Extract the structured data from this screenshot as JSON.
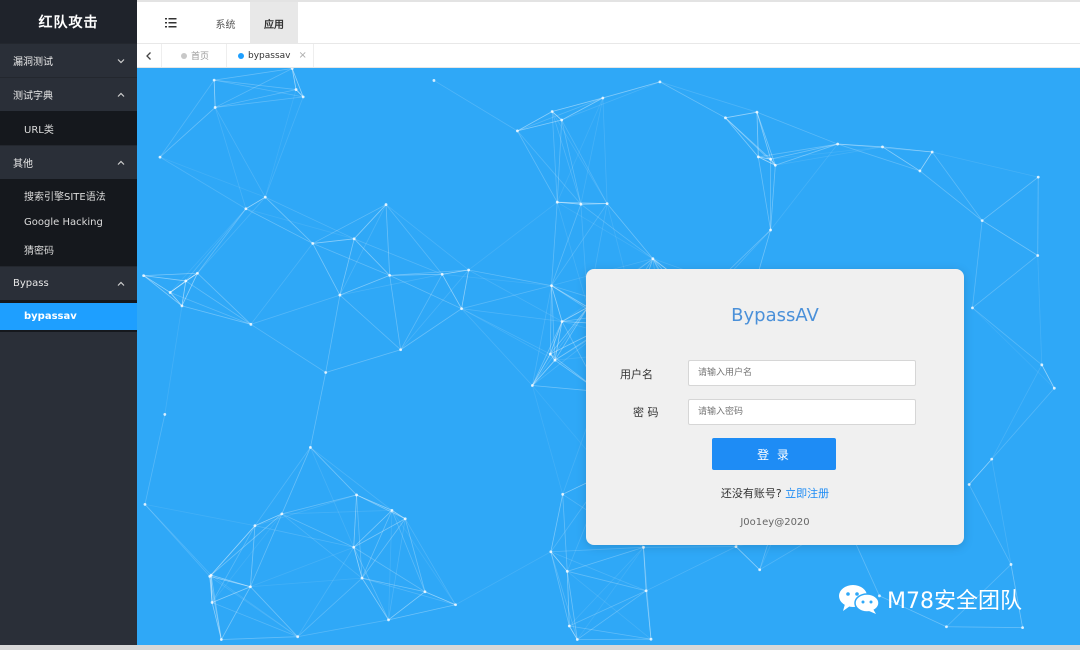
{
  "sidebar": {
    "brand": "红队攻击",
    "groups": [
      {
        "label": "漏洞测试"
      },
      {
        "label": "测试字典",
        "items": [
          "URL类"
        ]
      },
      {
        "label": "其他",
        "items": [
          "搜索引擎SITE语法",
          "Google Hacking",
          "猜密码"
        ]
      },
      {
        "label": "Bypass",
        "items": [
          "bypassav"
        ]
      }
    ]
  },
  "topbar": {
    "tabs": [
      "系统",
      "应用"
    ]
  },
  "tabrow": {
    "tabs": [
      "首页",
      "bypassav"
    ],
    "close_glyph": "×"
  },
  "login": {
    "title": "BypassAV",
    "username_label": "用户名",
    "username_placeholder": "请输入用户名",
    "password_label": "密 码",
    "password_placeholder": "请输入密码",
    "submit_label": "登 录",
    "register_prompt": "还没有账号?",
    "register_link": "立即注册",
    "copyright": "J0o1ey@2020"
  },
  "watermark": {
    "text": "M78安全团队"
  },
  "colors": {
    "sidebar_bg": "#2a2f38",
    "accent": "#1e9fff",
    "content_bg": "#2fa8f7",
    "button": "#1e8cf5"
  }
}
